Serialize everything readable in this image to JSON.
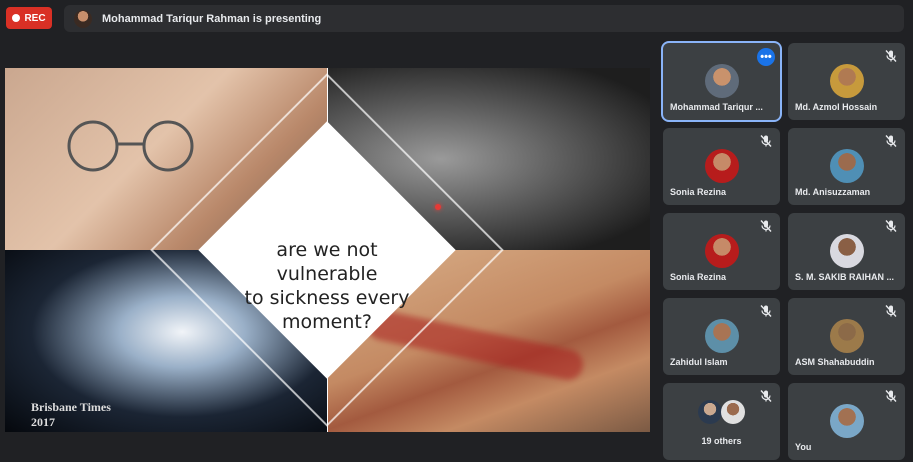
{
  "recording": {
    "label": "REC"
  },
  "presenter_bar": {
    "text": "Mohammad Tariqur Rahman is presenting"
  },
  "slide": {
    "text_lines": [
      "are we not vulnerable",
      "to sickness every",
      "moment?"
    ],
    "watermark_line1": "Brisbane Times",
    "watermark_line2": "2017"
  },
  "participants": [
    {
      "name": "Mohammad Tariqur ...",
      "active": true,
      "more_label": "•••",
      "color": "#5f6b7a"
    },
    {
      "name": "Md. Azmol Hossain",
      "muted": true,
      "color": "#c79a3c"
    },
    {
      "name": "Sonia Rezina",
      "muted": true,
      "color": "#b71c1c"
    },
    {
      "name": "Md. Anisuzzaman",
      "muted": true,
      "color": "#4f8fb5"
    },
    {
      "name": "Sonia Rezina",
      "muted": true,
      "color": "#b71c1c"
    },
    {
      "name": "S. M. SAKIB RAIHAN ...",
      "muted": true,
      "color": "#d9d9e0"
    },
    {
      "name": "Zahidul Islam",
      "muted": true,
      "color": "#5d8fa8"
    },
    {
      "name": "ASM Shahabuddin",
      "muted": true,
      "color": "#9c7a4a"
    },
    {
      "name": "19 others",
      "muted": true
    },
    {
      "name": "You",
      "muted": true,
      "color": "#7aa7c7"
    }
  ],
  "colors": {
    "background": "#202124",
    "tile": "#3c4043",
    "accent": "#8ab4f8",
    "rec": "#d93025"
  },
  "icons": {
    "muted": "mic-off-icon",
    "more": "more-options-icon"
  }
}
